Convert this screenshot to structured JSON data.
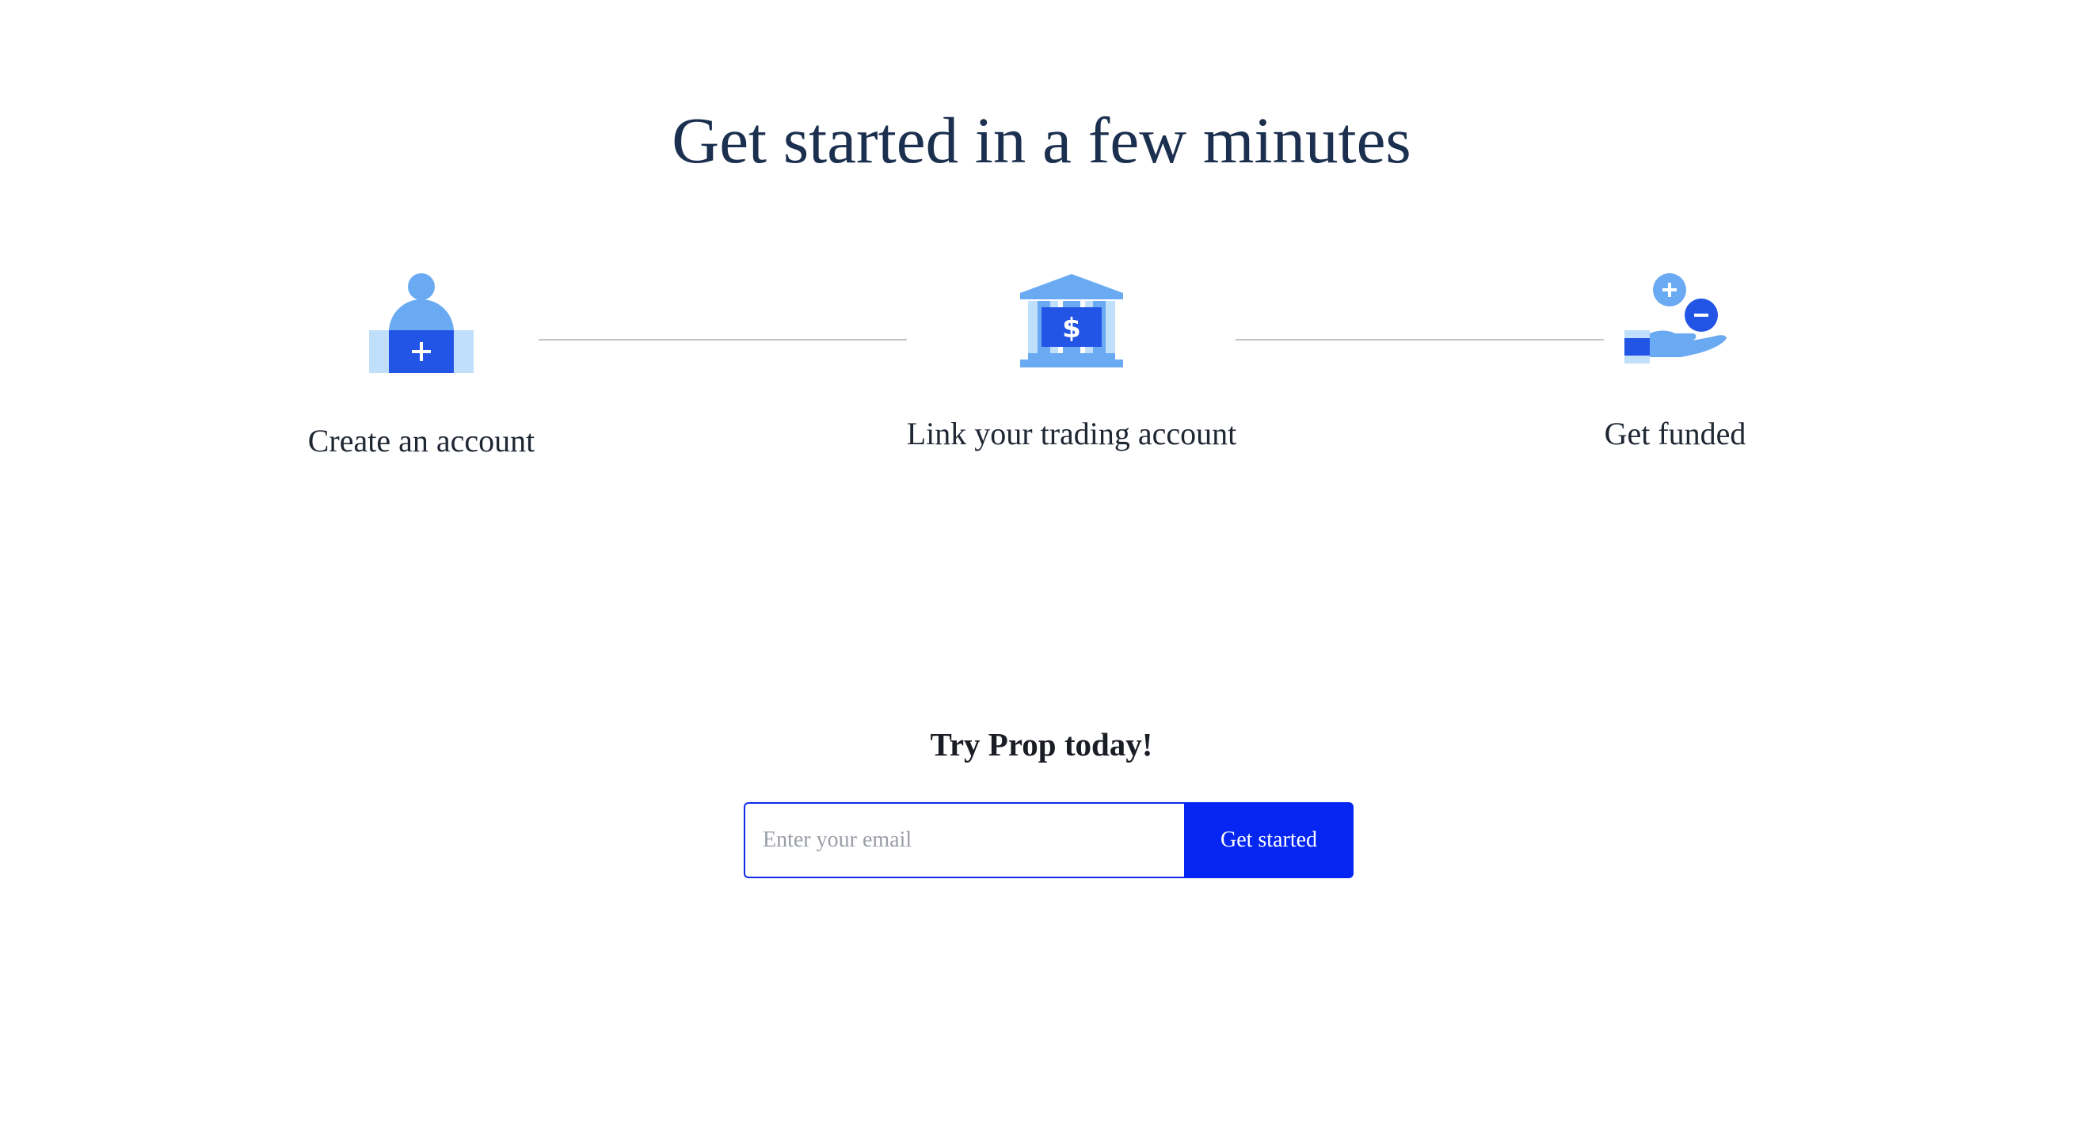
{
  "headline": "Get started in a few minutes",
  "steps": [
    {
      "label": "Create an account",
      "icon": "add-user-icon"
    },
    {
      "label": "Link your trading account",
      "icon": "bank-icon"
    },
    {
      "label": "Get funded",
      "icon": "hand-with-coins-icon"
    }
  ],
  "cta": {
    "title": "Try Prop today!",
    "email_placeholder": "Enter your email",
    "button_label": "Get started"
  },
  "colors": {
    "heading": "#1b2f4f",
    "icon_light": "#6aaaf2",
    "icon_pale": "#bfdffa",
    "icon_dark": "#2254e6",
    "button": "#0526f2",
    "connector": "#c0c4c9"
  }
}
